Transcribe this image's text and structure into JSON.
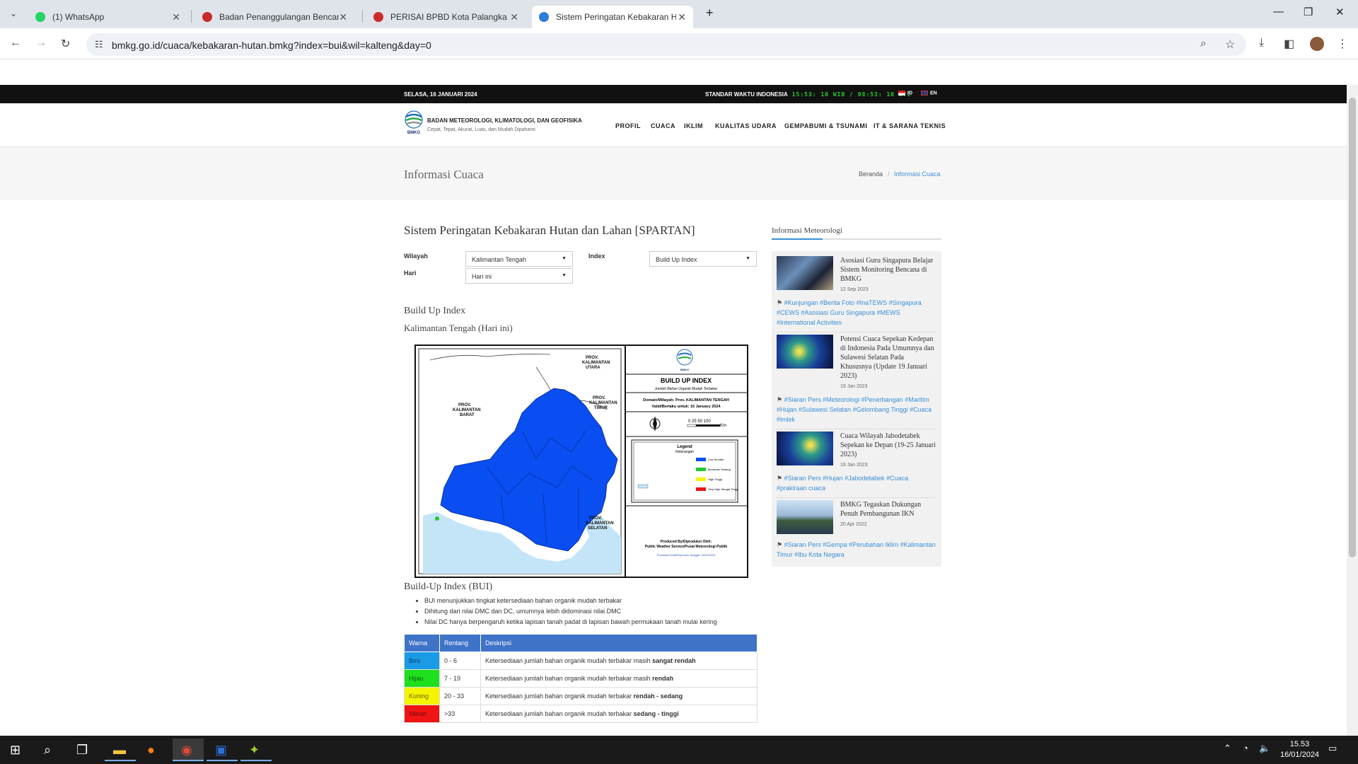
{
  "browser": {
    "tabs": [
      {
        "title": "(1) WhatsApp",
        "color": "#25d366"
      },
      {
        "title": "Badan Penanggulangan Bencana",
        "color": "#cc2a2a"
      },
      {
        "title": "PERISAI BPBD Kota Palangka Raya",
        "color": "#cc2a2a"
      },
      {
        "title": "Sistem Peringatan Kebakaran Hutan",
        "color": "#2f7bd8",
        "active": true
      }
    ],
    "url": "bmkg.go.id/cuaca/kebakaran-hutan.bmkg?index=bui&wil=kalteng&day=0"
  },
  "topbar": {
    "date": "SELASA, 16 JANUARI 2024",
    "swi_label": "STANDAR WAKTU INDONESIA",
    "clock": "15:53: 10 WIB / 08:53: 10 UTC",
    "lang_id": "ID",
    "lang_en": "EN"
  },
  "header": {
    "org_name": "BADAN METEOROLOGI, KLIMATOLOGI, DAN GEOFISIKA",
    "tagline": "Cepat, Tepat, Akurat, Luas, dan Mudah Dipahami",
    "logo_text": "BMKG",
    "menu": [
      "PROFIL",
      "CUACA",
      "IKLIM",
      "KUALITAS UDARA",
      "GEMPABUMI & TSUNAMI",
      "IT & SARANA TEKNIS"
    ]
  },
  "band": {
    "title": "Informasi Cuaca",
    "breadcrumb_home": "Beranda",
    "breadcrumb_current": "Informasi Cuaca"
  },
  "main": {
    "title": "Sistem Peringatan Kebakaran Hutan dan Lahan [SPARTAN]",
    "filters": {
      "wilayah_label": "Wilayah",
      "wilayah_value": "Kalimantan Tengah",
      "index_label": "Index",
      "index_value": "Build Up Index",
      "hari_label": "Hari",
      "hari_value": "Hari ini"
    },
    "section_title": "Build Up Index",
    "section_subtitle": "Kalimantan Tengah (Hari ini)",
    "map": {
      "title": "BUILD UP INDEX",
      "subtitle": "Jumlah Bahan Organik Mudah Terbakar",
      "domain": "Domain/Wilayah: Prov. KALIMANTAN TENGAH",
      "valid": "Valid/Berlaku untuk: 16 January 2024",
      "scale": "0  25 50     100",
      "scale_unit": "Km",
      "legend_title": "Legend",
      "legend_sub": "Keterangan",
      "legend_items": [
        "Low Rendah",
        "Moderate Sedang",
        "High Tinggi",
        "Very High Sangat Tinggi"
      ],
      "producer": "Produced By/Diproduksi Oleh:",
      "producer2": "Public Weather Service/Pusat Meteorologi Publik",
      "processed": "Processed Date/Diproses Tanggal: 15/01/2024",
      "labels": [
        "PROV. KALIMANTAN UTARA",
        "PROV. KALIMANTAN BARAT",
        "PROV. KALIMANTAN TIMUR",
        "PROV. KALIMANTAN SELATAN"
      ],
      "colors": {
        "low": "#0a4df0",
        "moderate": "#22c92a",
        "high": "#f4f400",
        "very_high": "#f01414",
        "sea": "#c4e4f8"
      }
    },
    "bui_title": "Build-Up Index (BUI)",
    "bullets": [
      "BUI menunjukkan tingkat ketersediaan bahan organik mudah terbakar",
      "Dihitung dari nilai DMC dan DC, umumnya lebih didominasi nilai DMC",
      "Nilai DC hanya berpengaruh ketika lapisan tanah padat di lapisan bawah permukaan tanah mulai kering"
    ],
    "table": {
      "headers": [
        "Warna",
        "Rentang",
        "Deskripsi"
      ],
      "rows": [
        {
          "warna": "Biru",
          "color": "#1a9be6",
          "rentang": "0 - 6",
          "desc": "Ketersediaan jumlah bahan organik mudah terbakar masih ",
          "desc_bold": "sangat rendah"
        },
        {
          "warna": "Hijau",
          "color": "#1fe01f",
          "rentang": "7 - 19",
          "desc": "Ketersediaan jumlah bahan organik mudah terbakar masih ",
          "desc_bold": "rendah"
        },
        {
          "warna": "Kuning",
          "color": "#f4f400",
          "rentang": "20 - 33",
          "desc": "Ketersediaan jumlah bahan organik mudah terbakar ",
          "desc_bold": "rendah - sedang"
        },
        {
          "warna": "Merah",
          "color": "#f01414",
          "rentang": ">33",
          "desc": "Ketersediaan jumlah bahan organik mudah terbakar ",
          "desc_bold": "sedang - tinggi"
        }
      ]
    }
  },
  "sidebar": {
    "title": "Informasi Meteorologi",
    "news": [
      {
        "title": "Asosiasi Guru Singapura Belajar Sistem Monitoring Bencana di BMKG",
        "date": "12 Sep 2023",
        "tags": "#Kunjungan #Berita Foto #InaTEWS #Singapura #CEWS #Asosiasi Guru Singapura #MEWS #International Activities"
      },
      {
        "title": "Potensi Cuaca Sepekan Kedepan di Indonesia Pada Umumnya dan Sulawesi Selatan Pada Khususnya (Update 19 Januari 2023)",
        "date": "19 Jan 2023",
        "tags": "#Siaran Pers #Meteorologi #Penerbangan #Maritim #Hujan #Sulawesi Selatan #Gelombang Tinggi #Cuaca #imlek"
      },
      {
        "title": "Cuaca Wilayah Jabodetabek Sepekan ke Depan (19-25 Januari 2023)",
        "date": "19 Jan 2023",
        "tags": "#Siaran Pers #Hujan #Jabodetabek #Cuaca #prakiraan cuaca"
      },
      {
        "title": "BMKG Tegaskan Dukungan Penuh Pembangunan IKN",
        "date": "20 Apr 2022",
        "tags": "#Siaran Pers #Gempa #Perubahan Iklim #Kalimantan Timur #Ibu Kota Negara"
      }
    ]
  },
  "taskbar": {
    "time": "15.53",
    "date": "16/01/2024"
  }
}
